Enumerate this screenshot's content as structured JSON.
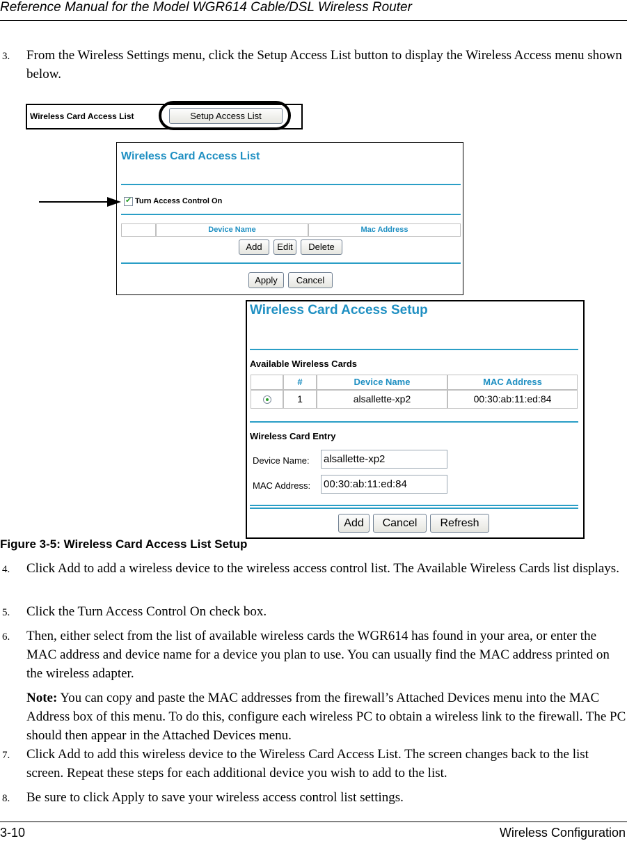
{
  "header": {
    "title": "Reference Manual for the Model WGR614 Cable/DSL Wireless Router"
  },
  "footer": {
    "page_number": "3-10",
    "section": "Wireless Configuration"
  },
  "steps_before": [
    {
      "num": "3.",
      "text": "From the Wireless Settings menu, click the Setup Access List button to display the Wireless Access menu shown below."
    }
  ],
  "figure": {
    "caption": "Figure 3-5: Wireless Card Access List Setup",
    "panel1": {
      "label": "Wireless Card Access List",
      "button": "Setup Access List"
    },
    "panel2": {
      "title": "Wireless Card Access List",
      "checkbox_label": "Turn Access Control On",
      "checkbox_checked": true,
      "columns": [
        "",
        "Device Name",
        "Mac Address"
      ],
      "buttons": {
        "add": "Add",
        "edit": "Edit",
        "delete": "Delete",
        "apply": "Apply",
        "cancel": "Cancel"
      }
    },
    "panel3": {
      "title": "Wireless Card Access Setup",
      "available_heading": "Available Wireless Cards",
      "columns": [
        "",
        "#",
        "Device Name",
        "MAC Address"
      ],
      "rows": [
        {
          "selected": true,
          "num": "1",
          "device_name": "alsallette-xp2",
          "mac": "00:30:ab:11:ed:84"
        }
      ],
      "entry_heading": "Wireless Card Entry",
      "device_name_label": "Device Name:",
      "device_name_value": "alsallette-xp2",
      "mac_label": "MAC Address:",
      "mac_value": "00:30:ab:11:ed:84",
      "buttons": {
        "add": "Add",
        "cancel": "Cancel",
        "refresh": "Refresh"
      }
    }
  },
  "steps_after": [
    {
      "num": "4.",
      "text": "Click Add to add a wireless device to the wireless access control list. The Available Wireless Cards list displays."
    },
    {
      "num": "5.",
      "text": "Click the Turn Access Control On check box."
    },
    {
      "num": "6.",
      "text": "Then, either select from the list of available wireless cards the WGR614 has found in your area, or enter the MAC address and device name for a device you plan to use. You can usually find the MAC address printed on the wireless adapter."
    },
    {
      "note_label": "Note:",
      "text": " You can copy and paste the MAC addresses from the firewall’s Attached Devices menu into the MAC Address box of this menu. To do this, configure each wireless PC to obtain a wireless link to the firewall. The PC should then appear in the Attached Devices menu."
    },
    {
      "num": "7.",
      "text": "Click Add to add this wireless device to the Wireless Card Access List. The screen changes back to the list screen. Repeat these steps for each additional device you wish to add to the list."
    },
    {
      "num": "8.",
      "text": "Be sure to click Apply to save your wireless access control list settings."
    }
  ]
}
